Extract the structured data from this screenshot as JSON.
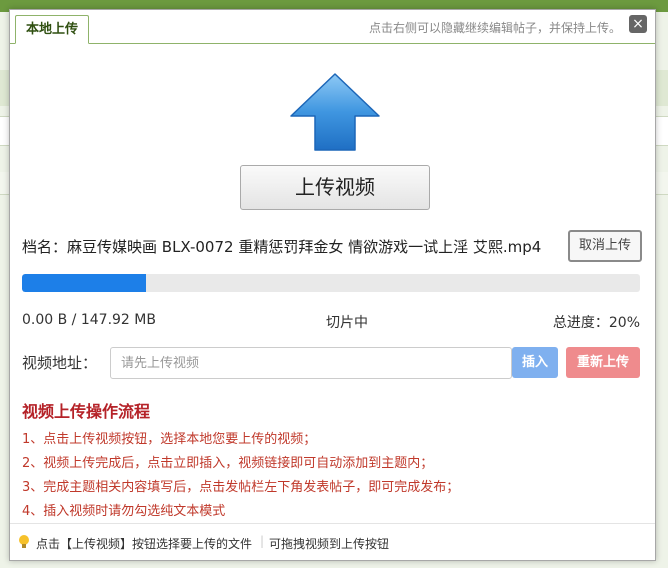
{
  "dialog": {
    "tab_label": "本地上传",
    "header_tip": "点击右侧可以隐藏继续编辑帖子，并保持上传。",
    "close_icon": "×"
  },
  "upload": {
    "button_label": "上传视频",
    "arrow_color": "#2e86de"
  },
  "file": {
    "name_prefix": "档名：",
    "name": "麻豆传媒映画 BLX-0072 重精惩罚拜金女 情欲游戏一试上淫 艾熙.mp4",
    "cancel_label": "取消上传"
  },
  "progress": {
    "percent": 20,
    "bar_fraction": 0.2,
    "size_text": "0.00 B / 147.92 MB",
    "status_text": "切片中",
    "total_label": "总进度：20%"
  },
  "video_url": {
    "label": "视频地址：",
    "placeholder": "请先上传视频",
    "value": "",
    "insert_label": "插入",
    "reupload_label": "重新上传"
  },
  "guide": {
    "title": "视频上传操作流程",
    "steps": [
      "1、点击上传视频按钮，选择本地您要上传的视频；",
      "2、视频上传完成后，点击立即插入，视频链接即可自动添加到主题内；",
      "3、完成主题相关内容填写后，点击发帖栏左下角发表帖子，即可完成发布；",
      "4、插入视频时请勿勾选纯文本模式"
    ]
  },
  "footer": {
    "tip": "点击【上传视频】按钮选择要上传的文件",
    "separator": "|",
    "tip2": "可拖拽视频到上传按钮"
  },
  "colors": {
    "progress_fill": "#1d7fe8",
    "insert_button": "#7fb0ef",
    "reupload_button": "#ef8b8d",
    "guide_text": "#c0392b"
  }
}
